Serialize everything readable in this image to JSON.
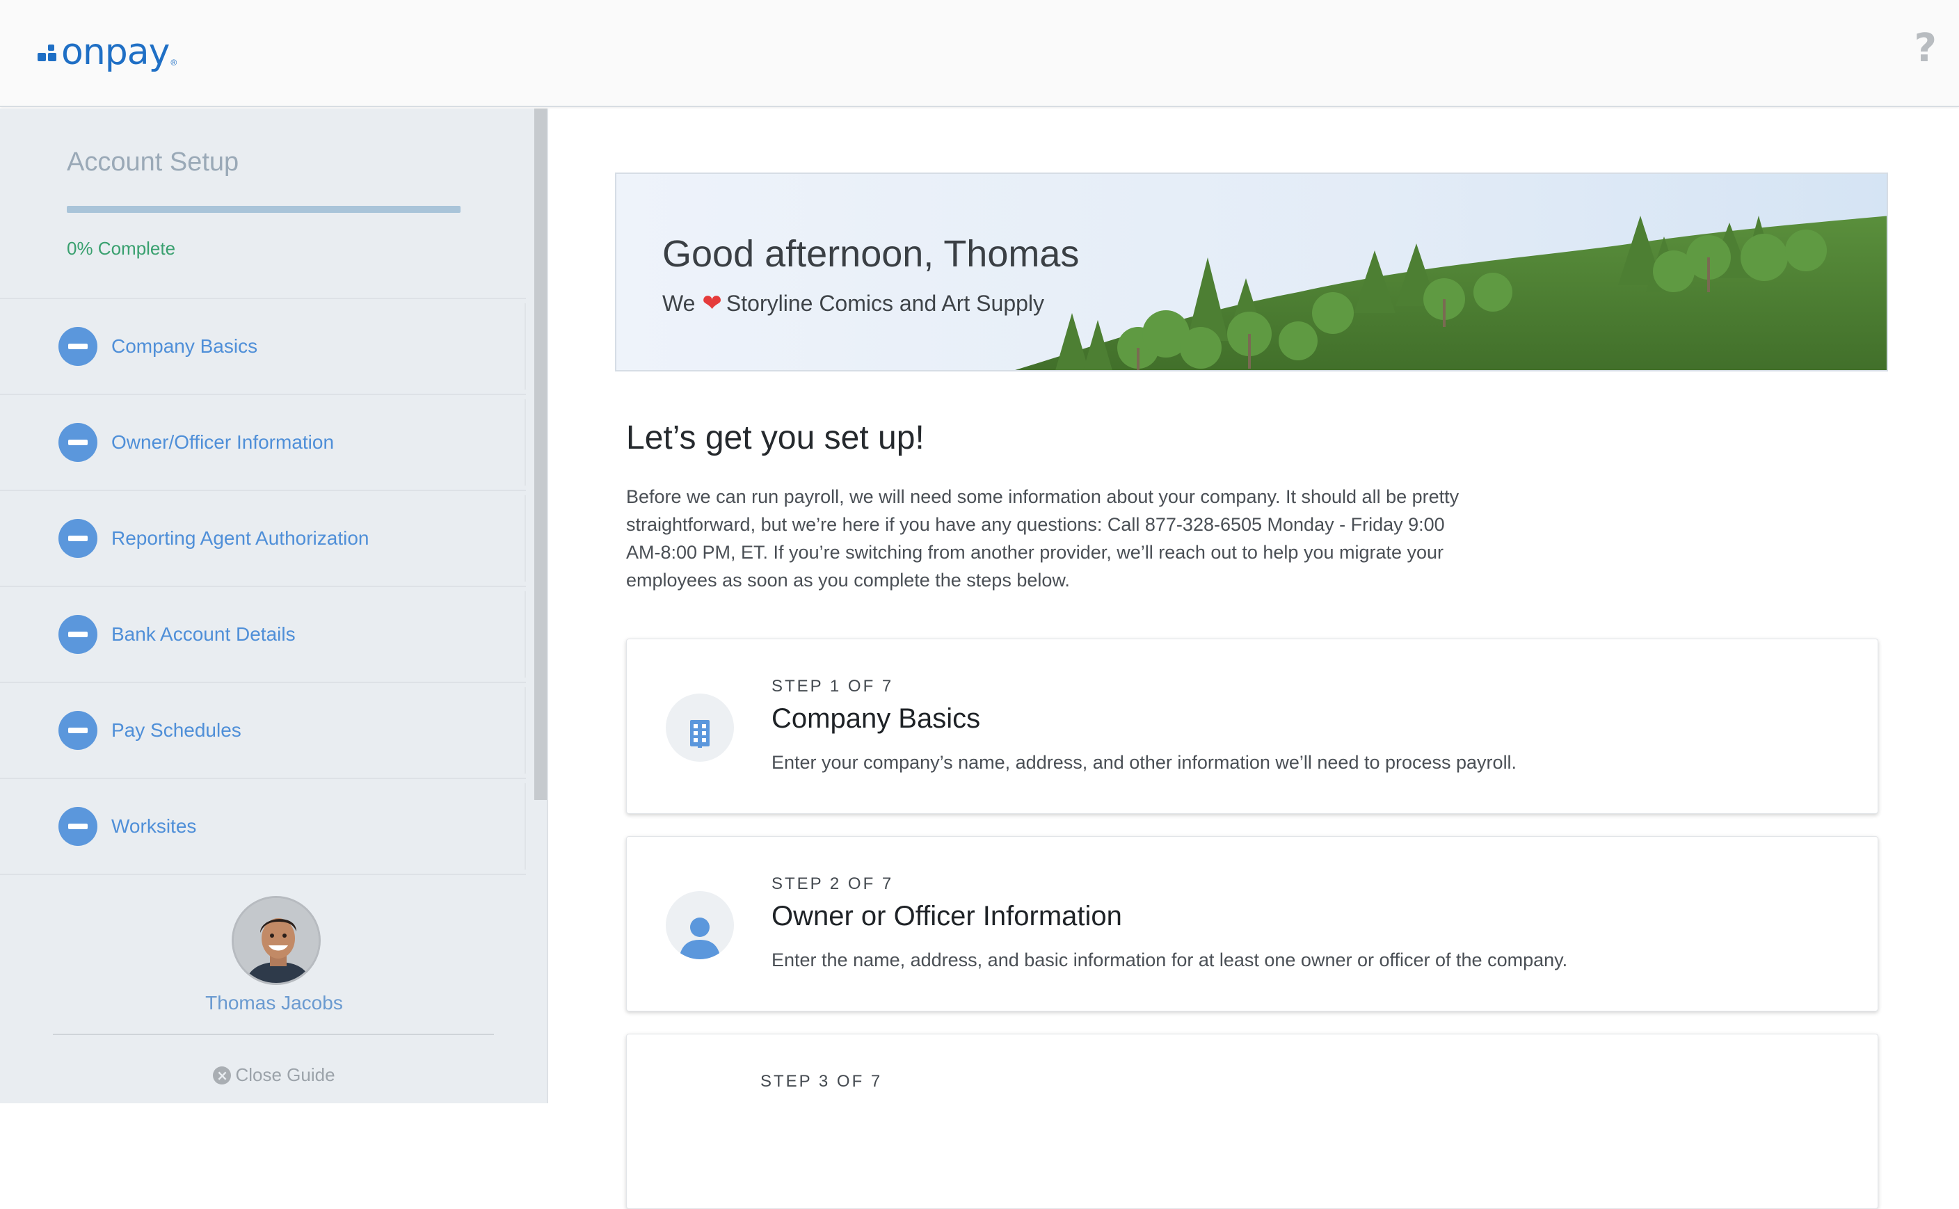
{
  "header": {
    "logo_text": "onpay",
    "logo_registered": "®",
    "help_icon": "?"
  },
  "sidebar": {
    "title": "Account Setup",
    "progress_percent": 0,
    "progress_text": "0% Complete",
    "items": [
      {
        "label": "Company Basics",
        "icon": "minus-circle-icon"
      },
      {
        "label": "Owner/Officer Information",
        "icon": "minus-circle-icon"
      },
      {
        "label": "Reporting Agent Authorization",
        "icon": "minus-circle-icon"
      },
      {
        "label": "Bank Account Details",
        "icon": "minus-circle-icon"
      },
      {
        "label": "Pay Schedules",
        "icon": "minus-circle-icon"
      },
      {
        "label": "Worksites",
        "icon": "minus-circle-icon"
      }
    ],
    "user_name": "Thomas Jacobs",
    "close_label": "Close Guide"
  },
  "banner": {
    "greeting": "Good afternoon, Thomas",
    "sub_prefix": "We",
    "heart_icon": "❤",
    "sub_suffix": "Storyline Comics and Art Supply"
  },
  "main": {
    "heading": "Let’s get you set up!",
    "intro_lines": [
      "Before we can run payroll, we will need some information about your company. It should all be pretty",
      "straightforward, but we’re here if you have any questions: Call 877-328-6505 Monday - Friday 9:00",
      "AM-8:00 PM, ET. If you’re switching from another provider, we’ll reach out to help you migrate your",
      "employees as soon as you complete the steps below."
    ],
    "steps": [
      {
        "label": "STEP 1 OF 7",
        "title": "Company Basics",
        "desc": "Enter your company’s name, address, and other information we’ll need to process payroll.",
        "icon": "building-icon"
      },
      {
        "label": "STEP 2 OF 7",
        "title": "Owner or Officer Information",
        "desc": "Enter the name, address, and basic information for at least one owner or officer of the company.",
        "icon": "person-icon"
      },
      {
        "label": "STEP 3 OF 7",
        "title": "",
        "desc": "",
        "icon": ""
      }
    ]
  },
  "colors": {
    "brand": "#1f6fc5",
    "sidebar_bg": "#e9edf1",
    "sidebar_link": "#4f8fd8",
    "progress_green": "#39a06f",
    "heart": "#e53b3b"
  }
}
